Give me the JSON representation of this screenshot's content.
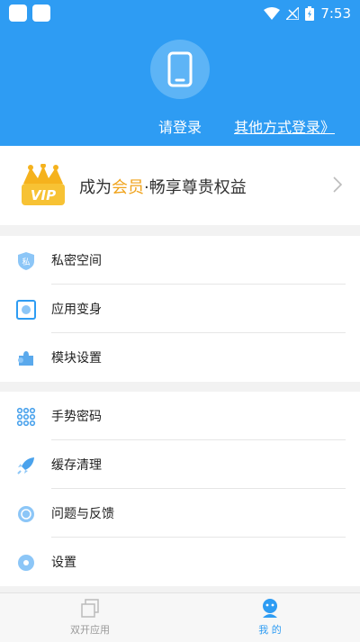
{
  "status_bar": {
    "time": "7:53"
  },
  "header": {
    "login_label": "请登录",
    "other_login_label": "其他方式登录》"
  },
  "vip": {
    "prefix": "成为",
    "highlight": "会员",
    "suffix": "·畅享尊贵权益",
    "badge_text": "VIP"
  },
  "menu_groups": [
    {
      "items": [
        {
          "label": "私密空间",
          "icon": "shield-icon"
        },
        {
          "label": "应用变身",
          "icon": "transform-icon"
        },
        {
          "label": "模块设置",
          "icon": "puzzle-icon"
        }
      ]
    },
    {
      "items": [
        {
          "label": "手势密码",
          "icon": "gesture-grid-icon"
        },
        {
          "label": "缓存清理",
          "icon": "rocket-icon"
        },
        {
          "label": "问题与反馈",
          "icon": "feedback-icon"
        },
        {
          "label": "设置",
          "icon": "settings-icon"
        }
      ]
    }
  ],
  "tabs": [
    {
      "label": "双开应用",
      "active": false,
      "color": "#999999"
    },
    {
      "label": "我 的",
      "active": true,
      "color": "#2e9cf3"
    }
  ],
  "colors": {
    "primary": "#2e9cf3",
    "vip_gold": "#f0a31c"
  }
}
